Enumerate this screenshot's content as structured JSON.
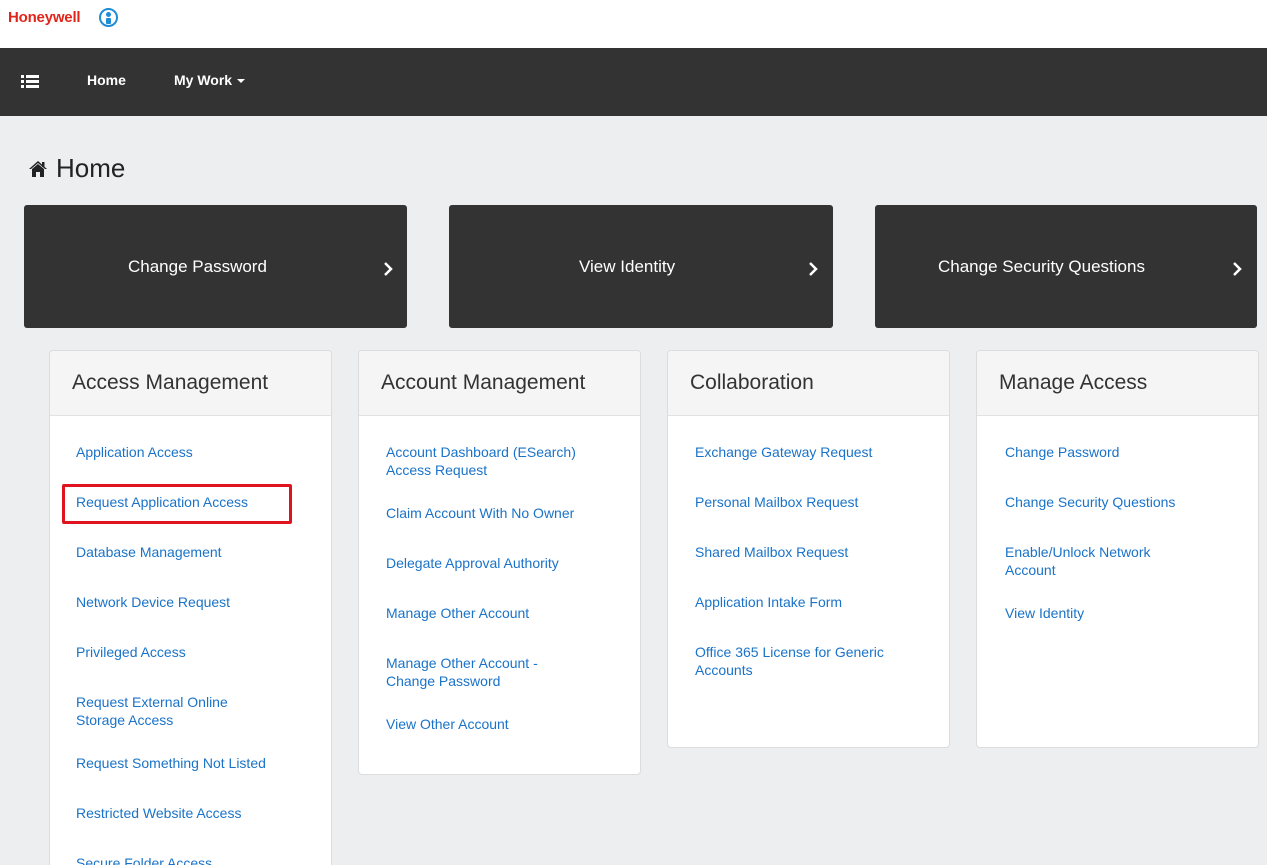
{
  "brand": {
    "name": "Honeywell",
    "icon": "user-circle-icon",
    "color": "#e1251b"
  },
  "nav": {
    "menu_icon": "list-icon",
    "items": [
      {
        "label": "Home"
      },
      {
        "label": "My Work",
        "dropdown": true
      }
    ]
  },
  "page": {
    "title": "Home",
    "icon": "home-icon"
  },
  "tiles": [
    {
      "label": "Change Password"
    },
    {
      "label": "View Identity"
    },
    {
      "label": "Change Security Questions"
    }
  ],
  "panels": [
    {
      "title": "Access Management",
      "links": [
        "Application Access",
        "Request Application Access",
        "Database Management",
        "Network Device Request",
        "Privileged Access",
        "Request External Online Storage Access",
        "Request Something Not Listed",
        "Restricted Website Access",
        "Secure Folder Access"
      ],
      "highlighted_index": 1
    },
    {
      "title": "Account Management",
      "links": [
        "Account Dashboard (ESearch) Access Request",
        "Claim Account With No Owner",
        "Delegate Approval Authority",
        "Manage Other Account",
        "Manage Other Account - Change Password",
        "View Other Account"
      ]
    },
    {
      "title": "Collaboration",
      "links": [
        "Exchange Gateway Request",
        "Personal Mailbox Request",
        "Shared Mailbox Request",
        "Application Intake Form",
        "Office 365 License for Generic Accounts"
      ]
    },
    {
      "title": "Manage Access",
      "links": [
        "Change Password",
        "Change Security Questions",
        "Enable/Unlock Network Account",
        "View Identity"
      ]
    }
  ],
  "colors": {
    "navbar": "#333333",
    "link": "#1a73c8",
    "highlight": "#e0141e",
    "background": "#eceef0"
  }
}
